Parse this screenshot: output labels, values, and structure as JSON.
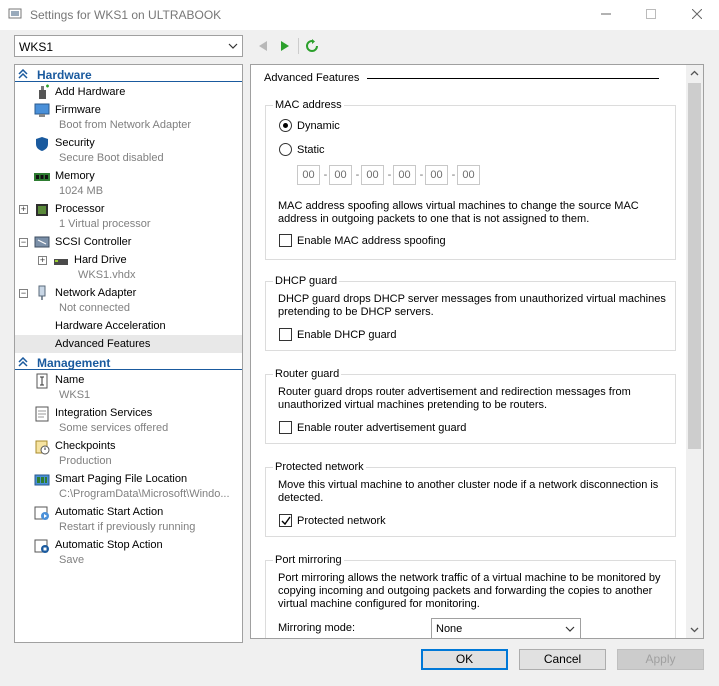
{
  "window": {
    "title": "Settings for WKS1 on ULTRABOOK",
    "controls": [
      "minimize",
      "maximize",
      "close"
    ]
  },
  "vm_selector": {
    "value": "WKS1"
  },
  "toolbar": {
    "icons": [
      "back-arrow-icon",
      "forward-arrow-icon",
      "refresh-icon"
    ]
  },
  "sidebar": {
    "hardware_label": "Hardware",
    "management_label": "Management",
    "items": [
      {
        "name": "Add Hardware",
        "sub": ""
      },
      {
        "name": "Firmware",
        "sub": "Boot from Network Adapter"
      },
      {
        "name": "Security",
        "sub": "Secure Boot disabled"
      },
      {
        "name": "Memory",
        "sub": "1024 MB"
      },
      {
        "name": "Processor",
        "sub": "1 Virtual processor"
      },
      {
        "name": "SCSI Controller",
        "sub": ""
      },
      {
        "name": "Hard Drive",
        "sub": "WKS1.vhdx"
      },
      {
        "name": "Network Adapter",
        "sub": "Not connected"
      },
      {
        "name": "Hardware Acceleration",
        "sub": ""
      },
      {
        "name": "Advanced Features",
        "sub": ""
      },
      {
        "name": "Name",
        "sub": "WKS1"
      },
      {
        "name": "Integration Services",
        "sub": "Some services offered"
      },
      {
        "name": "Checkpoints",
        "sub": "Production"
      },
      {
        "name": "Smart Paging File Location",
        "sub": "C:\\ProgramData\\Microsoft\\Windo..."
      },
      {
        "name": "Automatic Start Action",
        "sub": "Restart if previously running"
      },
      {
        "name": "Automatic Stop Action",
        "sub": "Save"
      }
    ]
  },
  "main": {
    "heading": "Advanced Features",
    "mac": {
      "title": "MAC address",
      "dynamic_label": "Dynamic",
      "static_label": "Static",
      "selected": "Dynamic",
      "octets": [
        "00",
        "00",
        "00",
        "00",
        "00",
        "00"
      ],
      "spoofing_desc": "MAC address spoofing allows virtual machines to change the source MAC address in outgoing packets to one that is not assigned to them.",
      "spoofing_label": "Enable MAC address spoofing",
      "spoofing_checked": false
    },
    "dhcp": {
      "title": "DHCP guard",
      "desc": "DHCP guard drops DHCP server messages from unauthorized virtual machines pretending to be DHCP servers.",
      "label": "Enable DHCP guard",
      "checked": false
    },
    "router": {
      "title": "Router guard",
      "desc": "Router guard drops router advertisement and redirection messages from unauthorized virtual machines pretending to be routers.",
      "label": "Enable router advertisement guard",
      "checked": false
    },
    "protected": {
      "title": "Protected network",
      "desc": "Move this virtual machine to another cluster node if a network disconnection is detected.",
      "label": "Protected network",
      "checked": true
    },
    "mirroring": {
      "title": "Port mirroring",
      "desc": "Port mirroring allows the network traffic of a virtual machine to be monitored by copying incoming and outgoing packets and forwarding the copies to another virtual machine configured for monitoring.",
      "mode_label": "Mirroring mode:",
      "mode_value": "None"
    }
  },
  "buttons": {
    "ok": "OK",
    "cancel": "Cancel",
    "apply": "Apply"
  },
  "colors": {
    "section_header": "#1a5a9e",
    "default_button_border": "#0078d7",
    "nav_arrow": "#2ca02c"
  }
}
